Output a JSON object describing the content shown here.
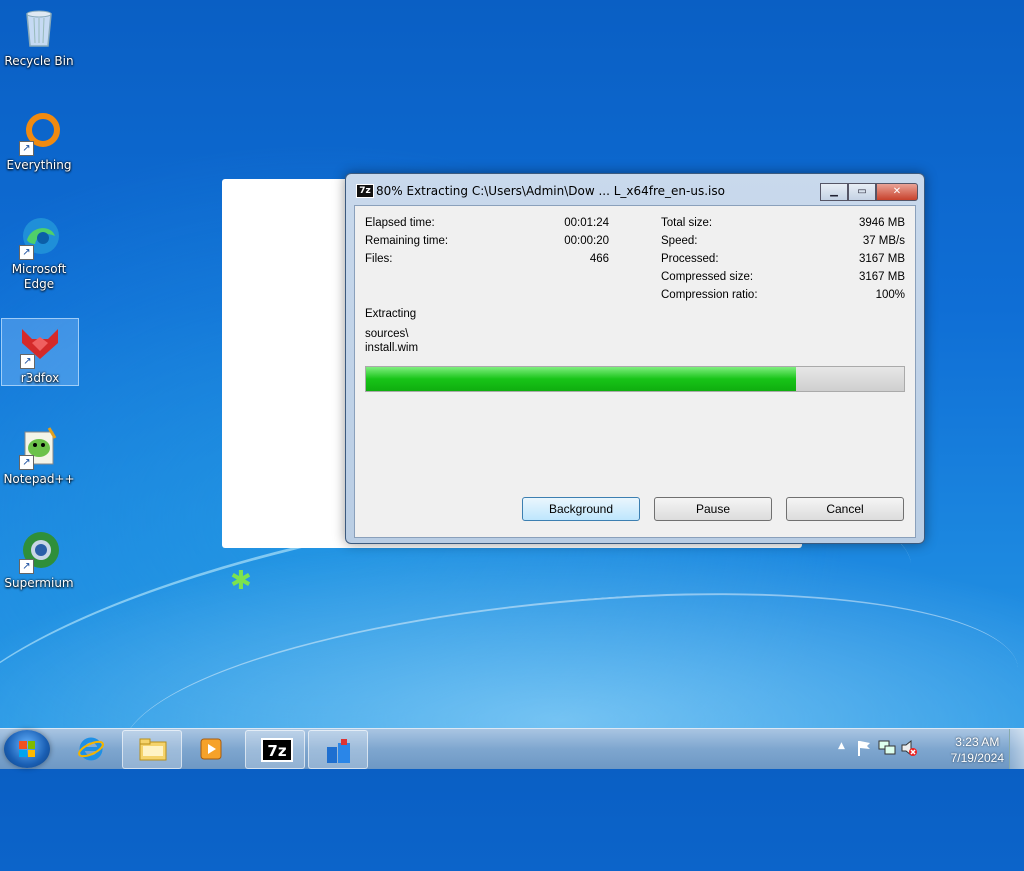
{
  "desktop": {
    "icons": [
      {
        "label": "Recycle Bin"
      },
      {
        "label": "Everything"
      },
      {
        "label": "Microsoft Edge"
      },
      {
        "label": "r3dfox"
      },
      {
        "label": "Notepad++"
      },
      {
        "label": "Supermium"
      }
    ]
  },
  "dialog": {
    "title": "80% Extracting C:\\Users\\Admin\\Dow ... L_x64fre_en-us.iso",
    "icon_text": "7z",
    "stats_left": [
      {
        "label": "Elapsed time:",
        "value": "00:01:24"
      },
      {
        "label": "Remaining time:",
        "value": "00:00:20"
      },
      {
        "label": "Files:",
        "value": "466"
      }
    ],
    "stats_right": [
      {
        "label": "Total size:",
        "value": "3946 MB"
      },
      {
        "label": "Speed:",
        "value": "37 MB/s"
      },
      {
        "label": "Processed:",
        "value": "3167 MB"
      },
      {
        "label": "Compressed size:",
        "value": "3167 MB"
      },
      {
        "label": "Compression ratio:",
        "value": "100%"
      }
    ],
    "status": "Extracting",
    "current_path": "sources\\",
    "current_file": "install.wim",
    "progress": 0.8,
    "buttons": {
      "background": "Background",
      "pause": "Pause",
      "cancel": "Cancel"
    }
  },
  "taskbar": {
    "time": "3:23 AM",
    "date": "7/19/2024",
    "tray_arrow": "▲"
  }
}
